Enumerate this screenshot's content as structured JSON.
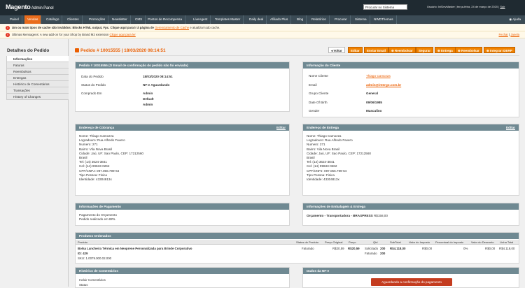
{
  "header": {
    "logo": "Magento",
    "logo_sub": "Admin Panel",
    "search_value": "Procurar no Sistema",
    "user_info": "Usuário: InfDevMaster | terça-feira, 24 de março de 2020 |",
    "logout": "Sair"
  },
  "nav": {
    "items": [
      "Painel",
      "Vendas",
      "Catálogo",
      "Clientes",
      "Promoções",
      "Newsletter",
      "CMS",
      "Pontos de Recompensa",
      "LiveAgent",
      "Templates Master",
      "Daily deal",
      "Afiliado Plus",
      "Blog",
      "Relatórios",
      "Procurar",
      "Sistema",
      "NWDThemes"
    ],
    "active": "Vendas",
    "help": "Ajuda"
  },
  "messages": {
    "cache": {
      "text": "Um ou mais tipos de cache são inválidos: Blocks HTML output, Fpc. Clique aqui para ir à página de",
      "link": "Gerenciamento de Cache",
      "suffix": "e atualizar todo cache."
    },
    "news": {
      "text": "Últimas Mensagens: A new add-on for your Shop by Brand M2 extension",
      "link": "Clique aqui para ler",
      "close": "Fechar",
      "dismiss": "Janela"
    }
  },
  "sidebar": {
    "title": "Detalhes do Pedido",
    "tabs": [
      "Informações",
      "Faturas",
      "Reembolsos",
      "Entregas",
      "Histórico de Comentários",
      "Transações",
      "History of Changes"
    ],
    "active": "Informações"
  },
  "page": {
    "title": "Pedido # 10015555 | 18/03/2020 08:14:51"
  },
  "toolbar": {
    "buttons": [
      "Voltar",
      "Editar",
      "Enviar Email",
      "Reembolsar",
      "Segurar",
      "Entrega",
      "Reembolsar",
      "Integrar IDERP"
    ]
  },
  "order": {
    "header": "Pedido # 10015555 (O Email de confirmação do pedido não foi enviado)",
    "rows": [
      {
        "label": "Data do Pedido",
        "value": "18/03/2020 08:14:51"
      },
      {
        "label": "Status do Pedido",
        "value": "NF-e Aguardando"
      },
      {
        "label": "Comprado Em",
        "value": "Admin"
      }
    ],
    "store_lines": [
      "Default",
      "Admin"
    ]
  },
  "account": {
    "header": "Informação do Cliente",
    "rows": [
      {
        "label": "Nome Cliente",
        "value": "Thiago Camozza"
      },
      {
        "label": "Email",
        "value": "admin@intergo.com.br"
      },
      {
        "label": "Grupo Cliente",
        "value": "General"
      },
      {
        "label": "Date Of Birth",
        "value": "09/06/1985"
      },
      {
        "label": "Gender",
        "value": "Masculino"
      }
    ]
  },
  "billing": {
    "header": "Endereço de Cobrança",
    "edit": "Editar",
    "lines": [
      "Nome: Thiago Camozza",
      "Logradouro: Rua Alfredo Favero",
      "Numero: 271",
      "Bairro: Vila Nova Brasil",
      "Cidade: Jaú, UF: Sao Paulo, CEP: 17212560",
      "Brasil",
      "Tel: (14) 3624-3841",
      "Cel: (14) 99633-0262",
      "CPF/CNPJ: 097.056.799-64",
      "Tipo Pessoa: Fisica",
      "Identidade: 43304813x"
    ]
  },
  "shipping": {
    "header": "Endereço de Entrega",
    "edit": "Editar",
    "lines": [
      "Nome: Thiago Camozza",
      "Logradouro: Rua Alfredo Favero",
      "Numero: 271",
      "Bairro: Vila Nova Brasil",
      "Cidade: Jaú, UF: Sao Paulo, CEP: 17212560",
      "Brasil",
      "Tel: (14) 3624-3841",
      "Cel: (14) 99633-0262",
      "CPF/CNPJ: 097.056.799-64",
      "Tipo Pessoa: Fisica",
      "Identidade: 43304813x"
    ]
  },
  "payment": {
    "header": "Informações de Pagamento",
    "lines": [
      "Pagamento do Orçamento",
      "Pedido realizado em BRL"
    ]
  },
  "shipping_method": {
    "header": "Informações de Embalagem & Entrega",
    "label": "Orçamento - Transportadora - BRASPRESS",
    "amount": "R$158,00"
  },
  "products": {
    "header": "Produtos Ordenados",
    "columns": [
      "Produto",
      "Status do Produto",
      "Preço Original",
      "Preço",
      "Qtd",
      "SubTotal",
      "Valor do Imposto",
      "Percentual do Imposto",
      "Valor do Desconto",
      "Linha Total"
    ],
    "row": {
      "name": "Bolsa Lancheira Térmica em Neoprene Personalizada para Brinde Corporativo",
      "id": "ID: 429",
      "sku": "SKU: 1.0079.000.02.000",
      "status": "Faturado",
      "original_price": "R$20,59",
      "price": "R$20,59",
      "qty_ordered_label": "Solicitado",
      "qty_ordered": "200",
      "qty_invoiced_label": "Faturado",
      "qty_invoiced": "200",
      "subtotal": "R$4.118,00",
      "tax": "R$0,00",
      "tax_percent": "0%",
      "discount": "R$0,00",
      "row_total": "R$4.118,00"
    }
  },
  "history": {
    "header": "Histórico de Comentários",
    "add_label": "Incluir Comentários",
    "status_label": "Status"
  },
  "nfe": {
    "header": "Dados da NF-e",
    "button": "Aguardando a confirmação do pagamento"
  }
}
